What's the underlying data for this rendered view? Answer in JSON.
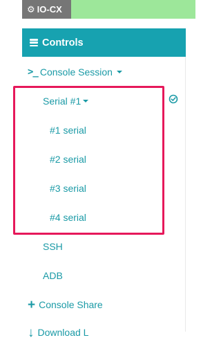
{
  "app": {
    "badge_label": "IO-CX",
    "badge_icon": "gear-icon"
  },
  "sidebar": {
    "header": {
      "label": "Controls",
      "icon": "hamburger-icon"
    },
    "console_session": {
      "label": "Console Session",
      "icon": "terminal-icon"
    },
    "serial_group": {
      "label": "Serial #1",
      "items": [
        {
          "label": "#1 serial"
        },
        {
          "label": "#2 serial"
        },
        {
          "label": "#3 serial"
        },
        {
          "label": "#4 serial"
        }
      ]
    },
    "ssh": {
      "label": "SSH"
    },
    "adb": {
      "label": "ADB"
    },
    "console_share": {
      "label": "Console Share",
      "icon": "plus-icon"
    },
    "download": {
      "label": "Download L",
      "icon": "download-icon"
    }
  },
  "colors": {
    "accent": "#17a2b0",
    "link": "#1a9aa6",
    "highlight": "#e6185a",
    "topbar": "#9de79a",
    "badge": "#767676"
  }
}
